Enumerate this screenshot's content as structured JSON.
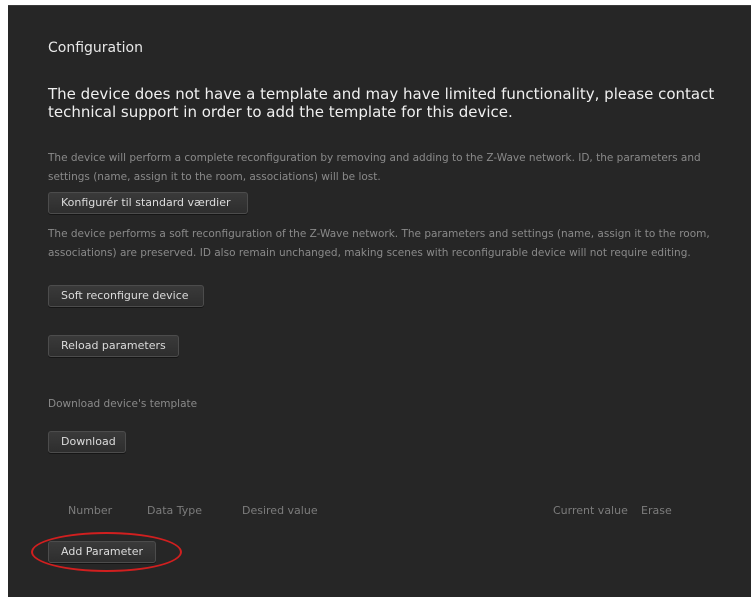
{
  "config": {
    "title": "Configuration",
    "warning": "The device does not have a template and may have limited functionality, please contact technical support in order to add the template for this device.",
    "reconfigure_desc": "The device will perform a complete reconfiguration by removing and adding to the Z-Wave network. ID, the parameters and settings (name, assign it to the room, associations) will be lost.",
    "reset_button": "Konfigurér til standard værdier",
    "soft_desc": "The device performs a soft reconfiguration of the Z-Wave network. The parameters and settings (name, assign it to the room, associations) are preserved. ID also remain unchanged, making scenes with reconfigurable device will not require editing.",
    "soft_button": "Soft reconfigure device",
    "reload_button": "Reload parameters",
    "download_desc": "Download device's template",
    "download_button": "Download",
    "add_parameter_button": "Add Parameter"
  },
  "table": {
    "columns": [
      "Number",
      "Data Type",
      "Desired value",
      "Current value",
      "Erase"
    ]
  },
  "colors": {
    "background": "#262626",
    "highlight_ring": "#d11f1f"
  }
}
